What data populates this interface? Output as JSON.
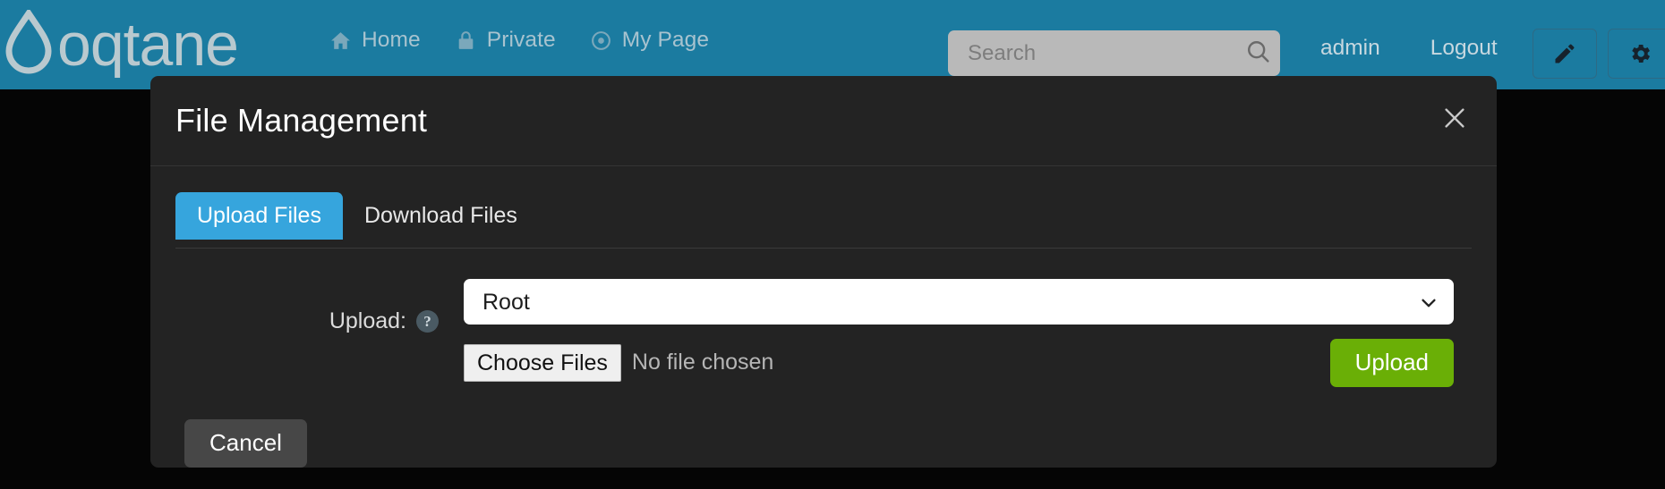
{
  "header": {
    "logo_text": "oqtane",
    "nav": [
      {
        "label": "Home",
        "icon": "home-icon"
      },
      {
        "label": "Private",
        "icon": "lock-icon"
      },
      {
        "label": "My Page",
        "icon": "target-icon"
      }
    ],
    "search": {
      "placeholder": "Search",
      "value": "",
      "icon": "search-icon"
    },
    "user": "admin",
    "logout": "Logout",
    "buttons": [
      {
        "name": "edit-page-button",
        "icon": "pencil-icon"
      },
      {
        "name": "settings-button",
        "icon": "gear-icon"
      }
    ],
    "colors": {
      "brand": "#1b7ba0",
      "nav_text": "#a8c3cf"
    }
  },
  "modal": {
    "title": "File Management",
    "close_label": "✕",
    "tabs": [
      {
        "label": "Upload Files",
        "active": true
      },
      {
        "label": "Download Files",
        "active": false
      }
    ],
    "form": {
      "upload_label": "Upload:",
      "help_glyph": "?",
      "folder": {
        "value": "Root",
        "options": [
          "Root"
        ]
      },
      "file_input": {
        "button_label": "Choose Files",
        "status": "No file chosen"
      },
      "upload_button": "Upload",
      "cancel_button": "Cancel"
    },
    "colors": {
      "surface": "#232323",
      "tab_active": "#36a5dd",
      "upload_green": "#6aaf06",
      "cancel_gray": "#474747"
    }
  }
}
